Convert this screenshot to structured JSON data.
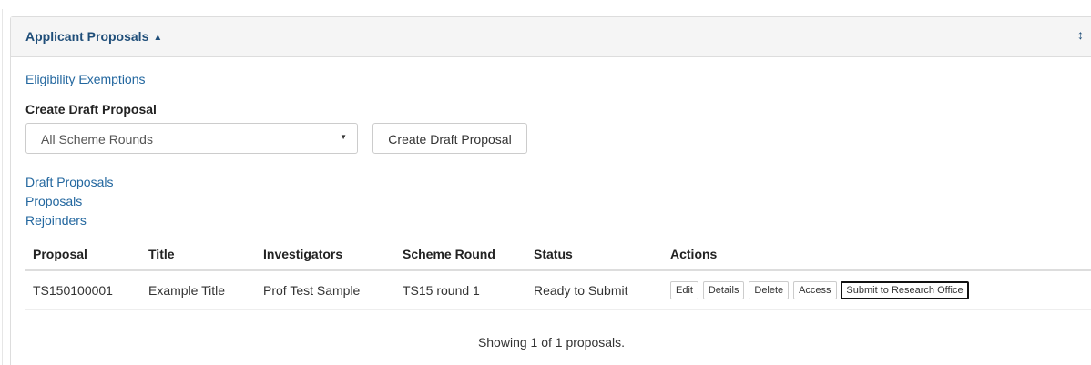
{
  "panel": {
    "title": "Applicant Proposals",
    "collapse_icon": "caret-up-icon",
    "resize_icon": "vertical-resize-icon"
  },
  "links": {
    "eligibility": "Eligibility Exemptions",
    "draft_proposals": "Draft Proposals",
    "proposals": "Proposals",
    "rejoinders": "Rejoinders"
  },
  "create": {
    "heading": "Create Draft Proposal",
    "select_value": "All Scheme Rounds",
    "button_label": "Create Draft Proposal"
  },
  "table": {
    "headers": [
      "Proposal",
      "Title",
      "Investigators",
      "Scheme Round",
      "Status",
      "Actions"
    ],
    "rows": [
      {
        "proposal": "TS150100001",
        "title": "Example Title",
        "investigators": "Prof Test Sample",
        "scheme_round": "TS15 round 1",
        "status": "Ready to Submit",
        "actions": [
          "Edit",
          "Details",
          "Delete",
          "Access",
          "Submit to Research Office"
        ]
      }
    ]
  },
  "footer": {
    "count_text": "Showing 1 of 1 proposals."
  }
}
